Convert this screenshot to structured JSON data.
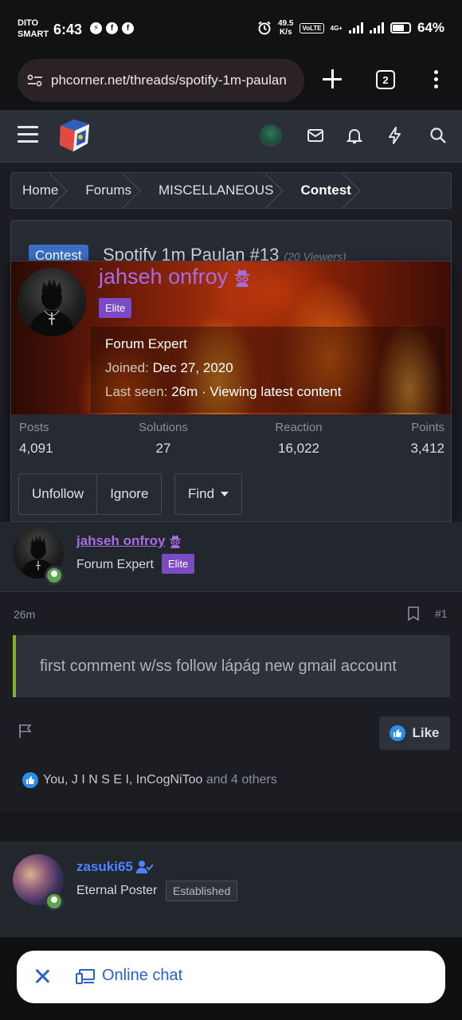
{
  "status_bar": {
    "carrier_line1": "DITO",
    "carrier_line2": "SMART",
    "time": "6:43",
    "net_speed_value": "49.5",
    "net_speed_unit": "K/s",
    "volte": "VoLTE",
    "network": "4G+",
    "battery": "64%"
  },
  "browser": {
    "url": "phcorner.net/threads/spotify-1m-paulan",
    "tab_count": "2"
  },
  "breadcrumb": [
    "Home",
    "Forums",
    "MISCELLANEOUS",
    "Contest"
  ],
  "thread": {
    "prefix": "Contest",
    "title": "Spotify 1m Paulan #13",
    "viewers": "(20 Viewers)"
  },
  "popup": {
    "name": "jahseh onfroy",
    "badge": "Elite",
    "rank": "Forum Expert",
    "joined_label": "Joined:",
    "joined_value": "Dec 27, 2020",
    "last_seen_label": "Last seen:",
    "last_seen_value": "26m · Viewing latest content",
    "stats": [
      {
        "label": "Posts",
        "value": "4,091"
      },
      {
        "label": "Solutions",
        "value": "27"
      },
      {
        "label": "Reaction",
        "value": "16,022"
      },
      {
        "label": "Points",
        "value": "3,412"
      }
    ],
    "buttons": {
      "unfollow": "Unfollow",
      "ignore": "Ignore",
      "find": "Find"
    }
  },
  "post1": {
    "author": "jahseh onfroy",
    "rank": "Forum Expert",
    "badge": "Elite",
    "time": "26m",
    "number": "#1",
    "body": "first comment w/ss follow lápág new gmail account",
    "like_label": "Like",
    "reactions": {
      "names": "You, J I N S E I, InCogNiToo",
      "suffix": "and 4 others"
    }
  },
  "post2": {
    "author": "zasuki65",
    "rank": "Eternal Poster",
    "badge": "Established"
  },
  "chat_bar": {
    "label": "Online chat"
  },
  "colors": {
    "accent_purple": "#a56de2",
    "link_blue": "#4f83ff",
    "quote_border": "#7cb32b",
    "like_blue": "#2b8fe6"
  }
}
